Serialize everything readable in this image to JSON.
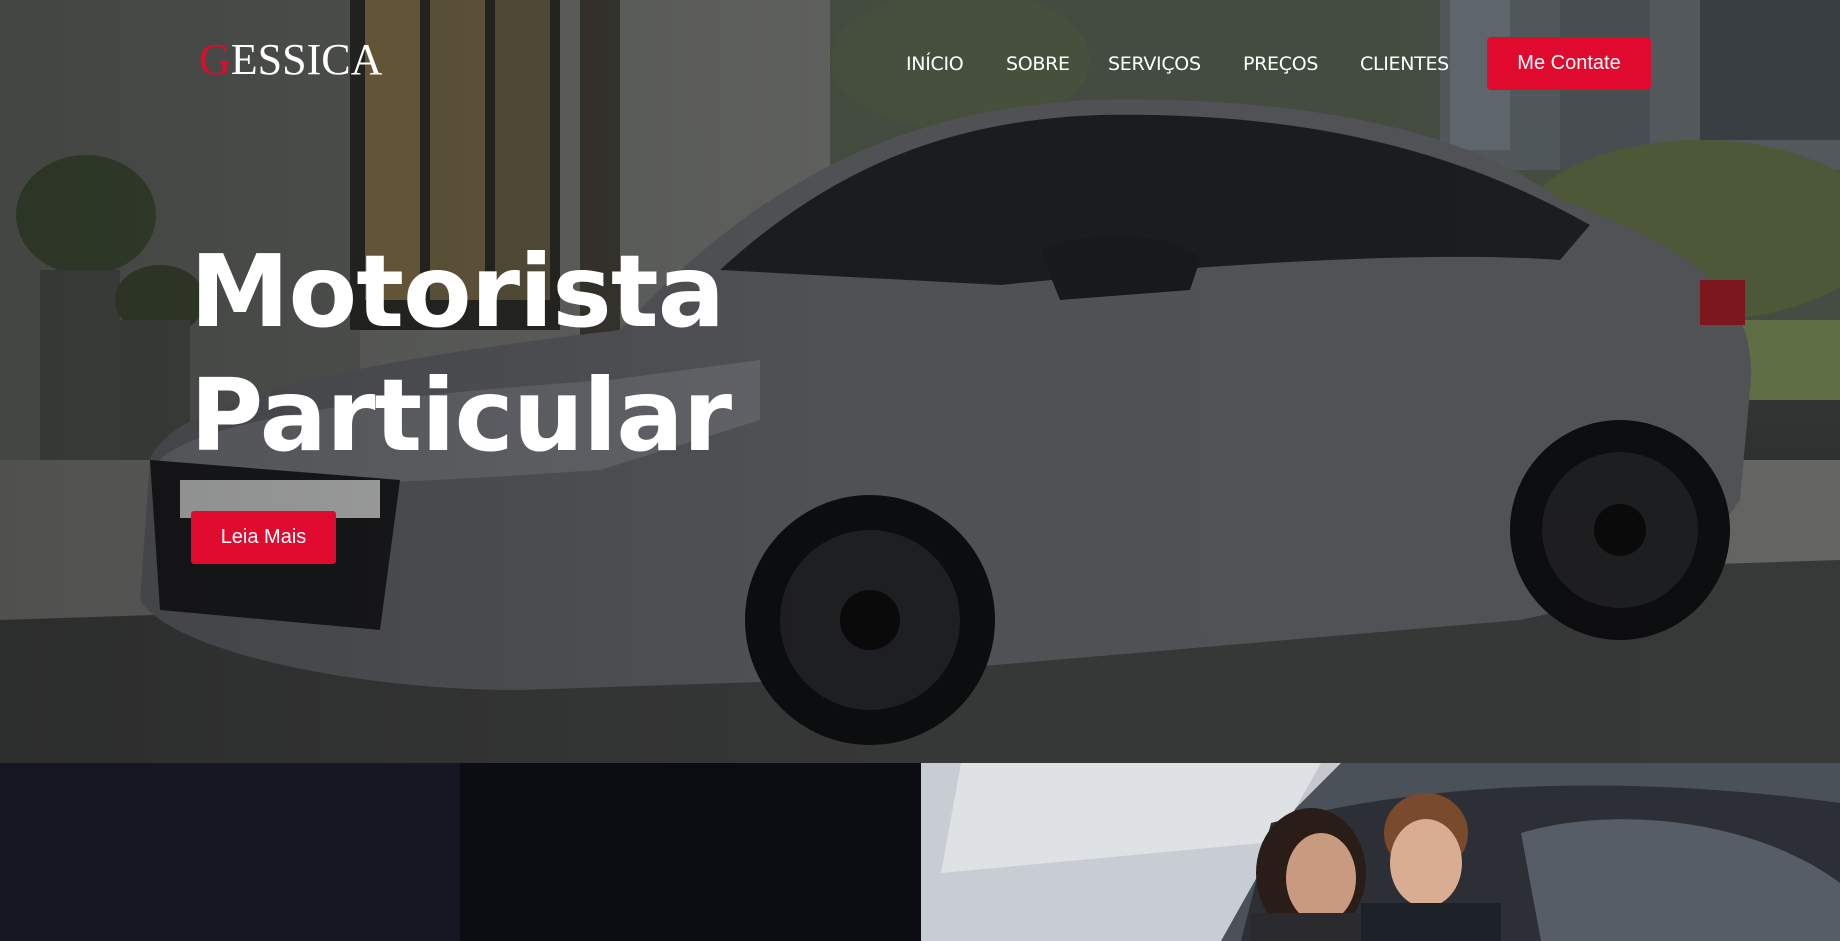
{
  "brand": {
    "logo_initial": "G",
    "logo_rest": "ESSICA",
    "accent_color": "#e20a2c"
  },
  "nav": {
    "items": [
      {
        "label": "INÍCIO"
      },
      {
        "label": "SOBRE"
      },
      {
        "label": "SERVIÇOS"
      },
      {
        "label": "PREÇOS"
      },
      {
        "label": "CLIENTES"
      }
    ],
    "cta_label": "Me Contate"
  },
  "hero": {
    "title_line1": "Motorista",
    "title_line2": "Particular",
    "button_label": "Leia Mais",
    "image": "gray-sedan-photo"
  },
  "sections": {
    "panel_a_color": "#171623",
    "panel_b_color": "#0c0d12",
    "panel_c_image": "couple-in-car-photo"
  }
}
